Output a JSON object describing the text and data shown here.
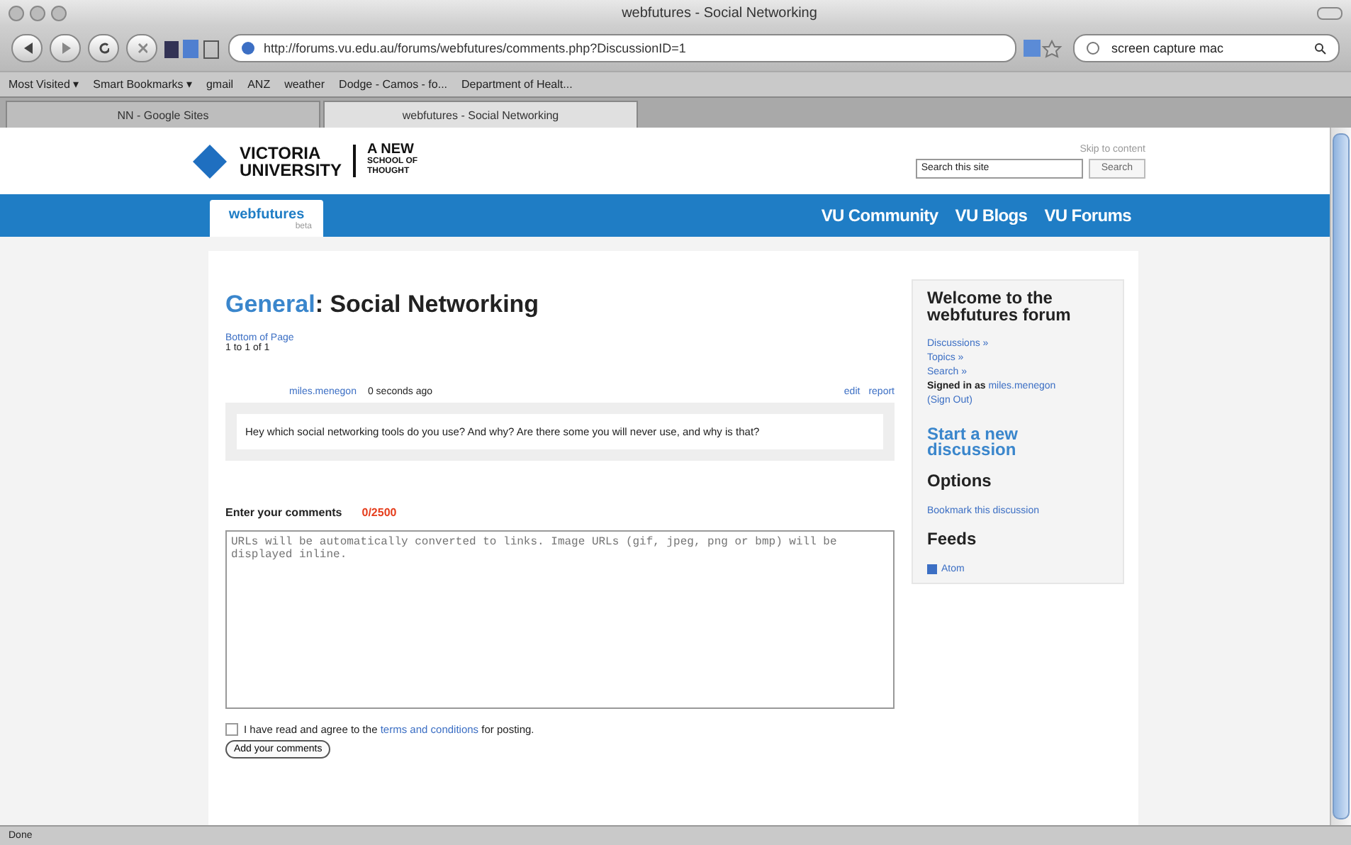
{
  "browser": {
    "title": "webfutures - Social Networking",
    "url": "http://forums.vu.edu.au/forums/webfutures/comments.php?DiscussionID=1",
    "search_value": "screen capture mac",
    "bookmarks": [
      "Most Visited ▾",
      "Smart Bookmarks ▾",
      "gmail",
      "ANZ",
      "weather",
      "Dodge - Camos - fo...",
      "Department of Healt..."
    ],
    "tabs": [
      {
        "label": "NN - Google Sites",
        "selected": false
      },
      {
        "label": "webfutures - Social Networking",
        "selected": true
      }
    ],
    "status": "Done"
  },
  "site": {
    "logo_line1": "VICTORIA",
    "logo_line2": "UNIVERSITY",
    "tagline": [
      "A NEW",
      "SCHOOL OF",
      "THOUGHT"
    ],
    "skip_link": "Skip to content",
    "search_value": "Search this site",
    "search_button": "Search",
    "forum_tab": {
      "label": "webfutures",
      "sub": "beta"
    },
    "nav": [
      "VU Community",
      "VU Blogs",
      "VU Forums"
    ]
  },
  "discussion": {
    "category": "General",
    "title": ": Social Networking",
    "bottom_link": "Bottom of Page",
    "paging": "1 to 1 of 1",
    "comment": {
      "author": "miles.menegon",
      "time": "0 seconds ago",
      "actions": [
        "edit",
        "report"
      ],
      "body": "Hey which social networking tools do you use? And why? Are there some you will never use, and why is that?"
    }
  },
  "form": {
    "label": "Enter your comments",
    "counter": "0/2500",
    "placeholder": "URLs will be automatically converted to links. Image URLs (gif, jpeg, png or bmp) will be displayed inline.",
    "agree_checked": false,
    "agree_before": "I have read and agree to the",
    "agree_link": "terms and conditions",
    "agree_after": "for posting.",
    "button": "Add your comments"
  },
  "sidebar": {
    "heading": "Welcome to the webfutures forum",
    "links": [
      "Discussions »",
      "Topics »",
      "Search »"
    ],
    "signed_prefix": "Signed in as",
    "user": "miles.menegon",
    "sign_out": "(Sign Out)",
    "start": "Start a new discussion",
    "options_heading": "Options",
    "options": [
      "Bookmark this discussion"
    ],
    "feeds_heading": "Feeds",
    "feeds": [
      "Atom"
    ]
  }
}
